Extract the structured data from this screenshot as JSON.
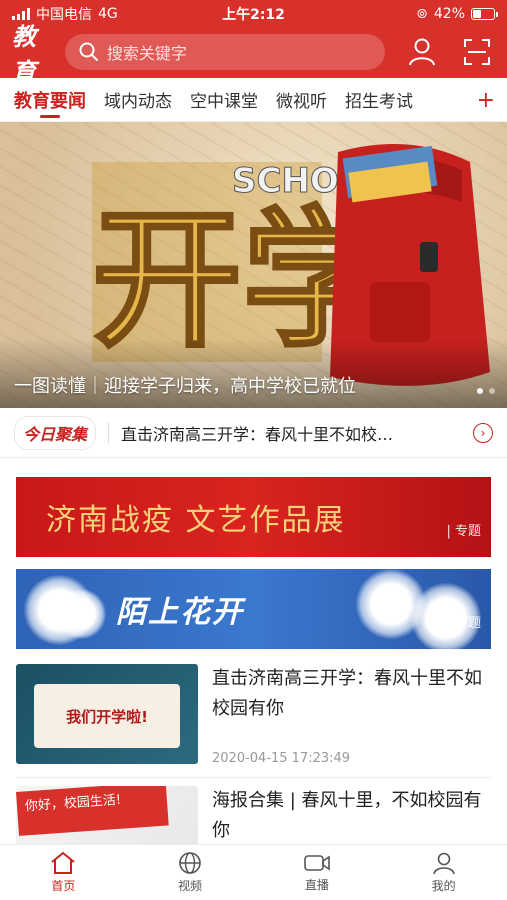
{
  "status": {
    "carrier": "中国电信",
    "network": "4G",
    "time": "上午2:12",
    "battery": "42%",
    "battery_level": 0.42
  },
  "header": {
    "logo_text": "教育",
    "search_placeholder": "搜索关键字"
  },
  "tabs": [
    {
      "label": "教育要闻",
      "active": true
    },
    {
      "label": "域内动态",
      "active": false
    },
    {
      "label": "空中课堂",
      "active": false
    },
    {
      "label": "微视听",
      "active": false
    },
    {
      "label": "招生考试",
      "active": false
    }
  ],
  "tab_add_label": "+",
  "banner": {
    "caption": "一图读懂｜迎接学子归来，高中学校已就位",
    "art_text": "开学",
    "slides": 2,
    "current": 1
  },
  "focus": {
    "badge": "今日聚集",
    "headline": "直击济南高三开学：春风十里不如校…"
  },
  "topics": [
    {
      "title": "济南战疫 文艺作品展",
      "tag": "| 专题"
    },
    {
      "title": "陌上花开",
      "tag": "| 专题"
    }
  ],
  "news": [
    {
      "title": "直击济南高三开学：春风十里不如校园有你",
      "time": "2020-04-15 17:23:49",
      "thumb_text": "我们开学啦!"
    },
    {
      "title": "海报合集 | 春风十里，不如校园有你",
      "time": "",
      "thumb_text": "你好，校园生活!"
    }
  ],
  "bottom_nav": [
    {
      "label": "首页",
      "icon": "home-icon",
      "active": true
    },
    {
      "label": "视频",
      "icon": "globe-icon",
      "active": false
    },
    {
      "label": "直播",
      "icon": "camera-icon",
      "active": false
    },
    {
      "label": "我的",
      "icon": "user-icon",
      "active": false
    }
  ],
  "colors": {
    "brand_red": "#d8302b",
    "accent_red": "#c8231e",
    "topic_blue": "#3b78cf"
  }
}
